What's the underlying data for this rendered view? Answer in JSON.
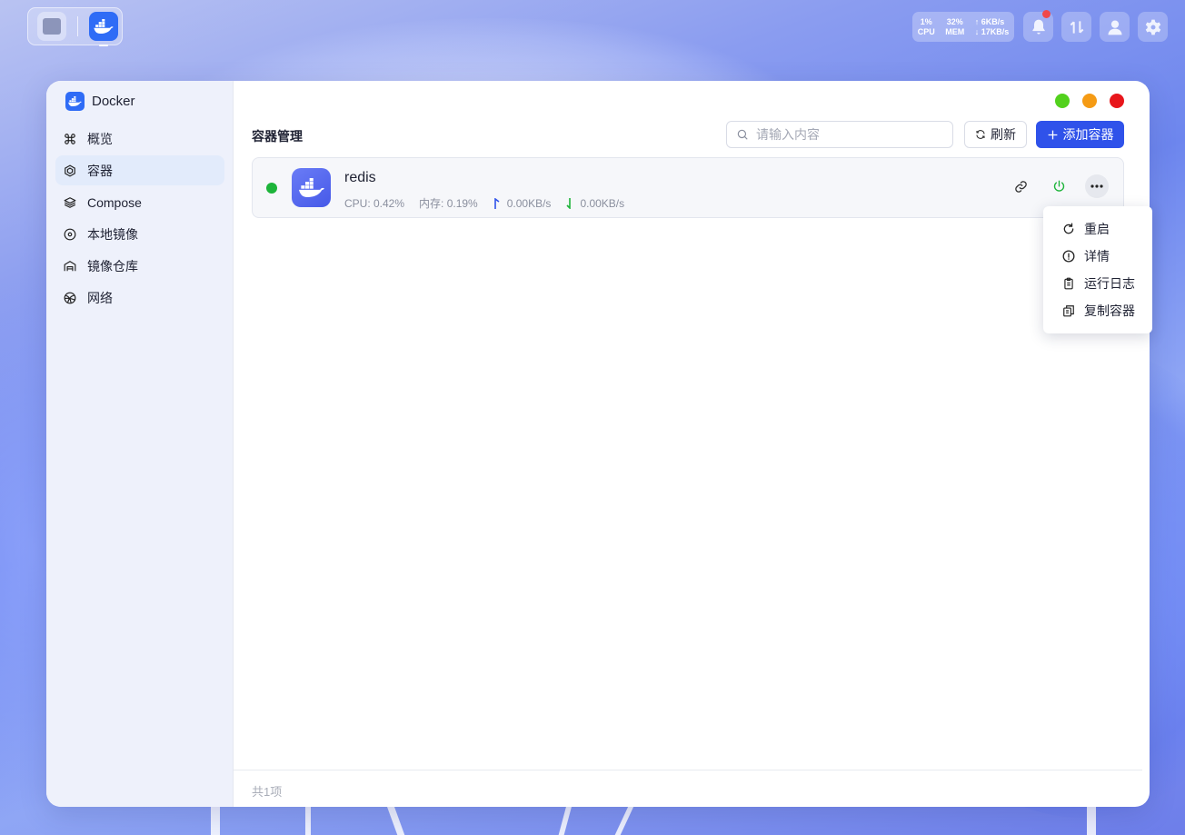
{
  "system": {
    "cpu_value": "1%",
    "cpu_label": "CPU",
    "mem_value": "32%",
    "mem_label": "MEM",
    "net_up": "↑ 6KB/s",
    "net_down": "↓ 17KB/s"
  },
  "app": {
    "name": "Docker"
  },
  "sidebar": {
    "items": [
      {
        "label": "概览",
        "icon": "command-icon",
        "active": false
      },
      {
        "label": "容器",
        "icon": "hexagon-icon",
        "active": true
      },
      {
        "label": "Compose",
        "icon": "layers-icon",
        "active": false
      },
      {
        "label": "本地镜像",
        "icon": "disc-icon",
        "active": false
      },
      {
        "label": "镜像仓库",
        "icon": "warehouse-icon",
        "active": false
      },
      {
        "label": "网络",
        "icon": "globe-icon",
        "active": false
      }
    ]
  },
  "main": {
    "title": "容器管理",
    "search_placeholder": "请输入内容",
    "refresh_label": "刷新",
    "add_label": "添加容器",
    "footer_count": "共1项"
  },
  "containers": [
    {
      "name": "redis",
      "status": "running",
      "cpu": "CPU: 0.42%",
      "mem": "内存: 0.19%",
      "up": "0.00KB/s",
      "down": "0.00KB/s"
    }
  ],
  "context_menu": {
    "items": [
      {
        "label": "重启",
        "icon": "restart-icon"
      },
      {
        "label": "详情",
        "icon": "info-icon"
      },
      {
        "label": "运行日志",
        "icon": "clipboard-icon"
      },
      {
        "label": "复制容器",
        "icon": "copy-icon"
      }
    ]
  },
  "colors": {
    "accent": "#2f52ea",
    "running": "#1db43a",
    "window_green": "#52d11d",
    "window_orange": "#f59b14",
    "window_red": "#e8161b"
  }
}
